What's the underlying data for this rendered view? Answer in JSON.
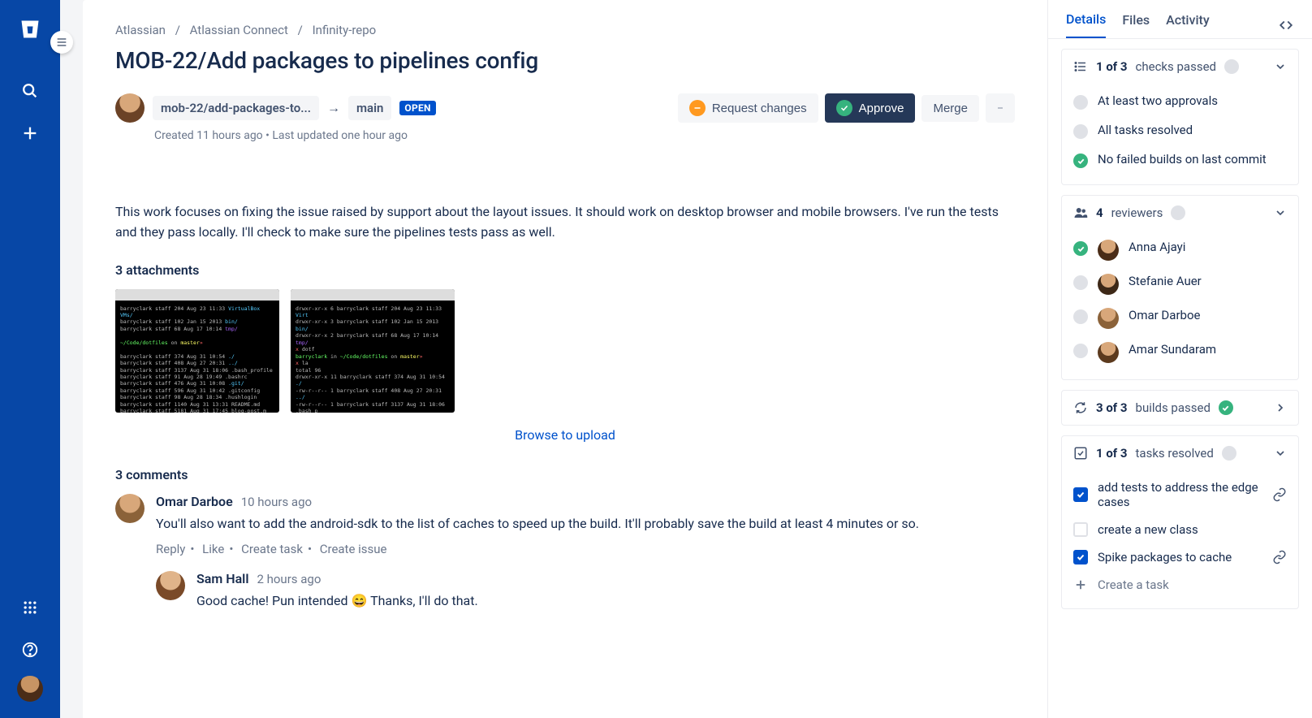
{
  "breadcrumb": {
    "org": "Atlassian",
    "project": "Atlassian Connect",
    "repo": "Infinity-repo"
  },
  "pr": {
    "title": "MOB-22/Add packages to pipelines config",
    "source_branch": "mob-22/add-packages-to...",
    "target_branch": "main",
    "status": "OPEN",
    "created": "Created 11 hours ago",
    "updated": "Last updated one hour ago",
    "description": "This work focuses on fixing the issue raised by support about the layout issues. It should work on desktop browser and mobile browsers. I've run the tests and they pass locally. I'll check to make sure the pipelines tests pass as well."
  },
  "actions": {
    "request_changes": "Request changes",
    "approve": "Approve",
    "merge": "Merge"
  },
  "attachments": {
    "heading": "3 attachments",
    "upload": "Browse to upload"
  },
  "comments": {
    "heading": "3 comments",
    "list": [
      {
        "author": "Omar Darboe",
        "time": "10 hours ago",
        "text": "You'll also want to add the android-sdk to the list of caches to speed up the build. It'll probably save the build at least 4 minutes or so."
      },
      {
        "author": "Sam Hall",
        "time": "2 hours ago",
        "text": "Good cache! Pun intended 😄 Thanks, I'll do that."
      }
    ],
    "ops": {
      "reply": "Reply",
      "like": "Like",
      "task": "Create task",
      "issue": "Create issue"
    }
  },
  "sidebar": {
    "tabs": {
      "details": "Details",
      "files": "Files",
      "activity": "Activity"
    },
    "checks": {
      "count": "1 of 3",
      "label": "checks passed",
      "items": [
        {
          "ok": false,
          "text": "At least two approvals"
        },
        {
          "ok": false,
          "text": "All tasks resolved"
        },
        {
          "ok": true,
          "text": "No failed builds on last commit"
        }
      ]
    },
    "reviewers": {
      "count": "4",
      "label": "reviewers",
      "list": [
        {
          "name": "Anna Ajayi",
          "approved": true,
          "color": "#4A2C17"
        },
        {
          "name": "Stefanie Auer",
          "approved": false,
          "color": "#3D2817"
        },
        {
          "name": "Omar Darboe",
          "approved": false,
          "color": "#8B6239"
        },
        {
          "name": "Amar Sundaram",
          "approved": false,
          "color": "#5C3A1E"
        }
      ]
    },
    "builds": {
      "count": "3 of 3",
      "label": "builds passed"
    },
    "tasks": {
      "count": "1 of 3",
      "label": "tasks resolved",
      "list": [
        {
          "done": true,
          "text": "add tests to address the edge cases",
          "link": true
        },
        {
          "done": false,
          "text": "create a new class",
          "link": false
        },
        {
          "done": true,
          "text": "Spike packages to cache",
          "link": true
        }
      ],
      "create": "Create a task"
    }
  }
}
